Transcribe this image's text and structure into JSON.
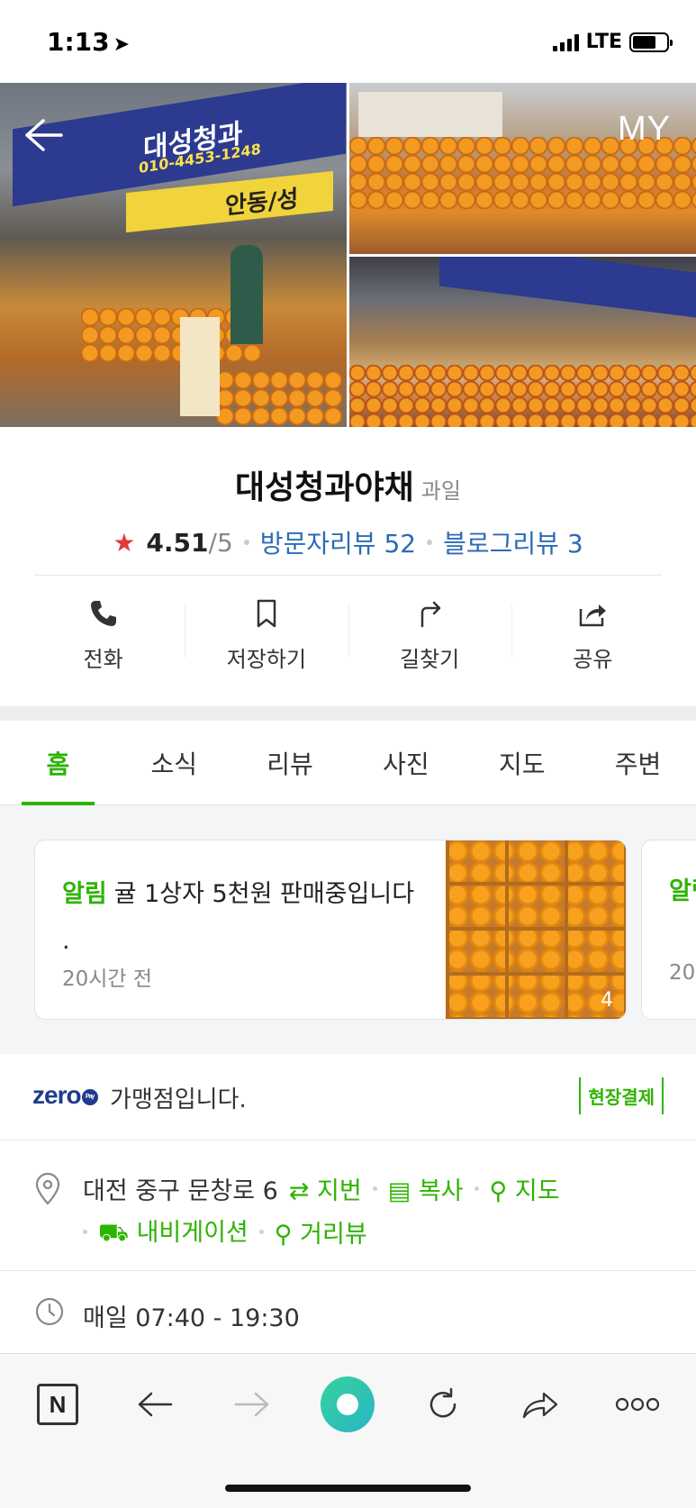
{
  "status_bar": {
    "time": "1:13",
    "network": "LTE"
  },
  "photo_header": {
    "back_icon": "arrow-left-icon",
    "my_label": "MY"
  },
  "place": {
    "name": "대성청과야채",
    "category": "과일",
    "rating": "4.51",
    "rating_max": "/5",
    "visitor_review_label": "방문자리뷰",
    "visitor_review_count": "52",
    "blog_review_label": "블로그리뷰",
    "blog_review_count": "3"
  },
  "actions": [
    {
      "icon": "phone-icon",
      "label": "전화"
    },
    {
      "icon": "bookmark-icon",
      "label": "저장하기"
    },
    {
      "icon": "directions-icon",
      "label": "길찾기"
    },
    {
      "icon": "share-icon",
      "label": "공유"
    }
  ],
  "tabs": [
    {
      "label": "홈",
      "active": true
    },
    {
      "label": "소식",
      "active": false
    },
    {
      "label": "리뷰",
      "active": false
    },
    {
      "label": "사진",
      "active": false
    },
    {
      "label": "지도",
      "active": false
    },
    {
      "label": "주변",
      "active": false
    }
  ],
  "notice": {
    "tag": "알림",
    "text": "귤 1상자 5천원 판매중입니다",
    "text_line2": ".",
    "time": "20시간 전",
    "photo_count": "4",
    "next_tag": "알림",
    "next_time": "20"
  },
  "zeropay": {
    "logo": "zero",
    "logo_badge": "Pay",
    "text": "가맹점입니다.",
    "badge": "현장결제"
  },
  "address": {
    "text": "대전 중구 문창로 6",
    "lot_number": "지번",
    "copy": "복사",
    "map": "지도",
    "navigation": "내비게이션",
    "street_view": "거리뷰"
  },
  "hours": {
    "text": "매일 07:40 - 19:30"
  },
  "banner_text": {
    "shop": "대성청과",
    "phone": "010-4453-1248",
    "sign": "안동/성"
  },
  "colors": {
    "accent": "#2db400",
    "link_blue": "#2b6bb7",
    "star": "#e23b3b"
  }
}
